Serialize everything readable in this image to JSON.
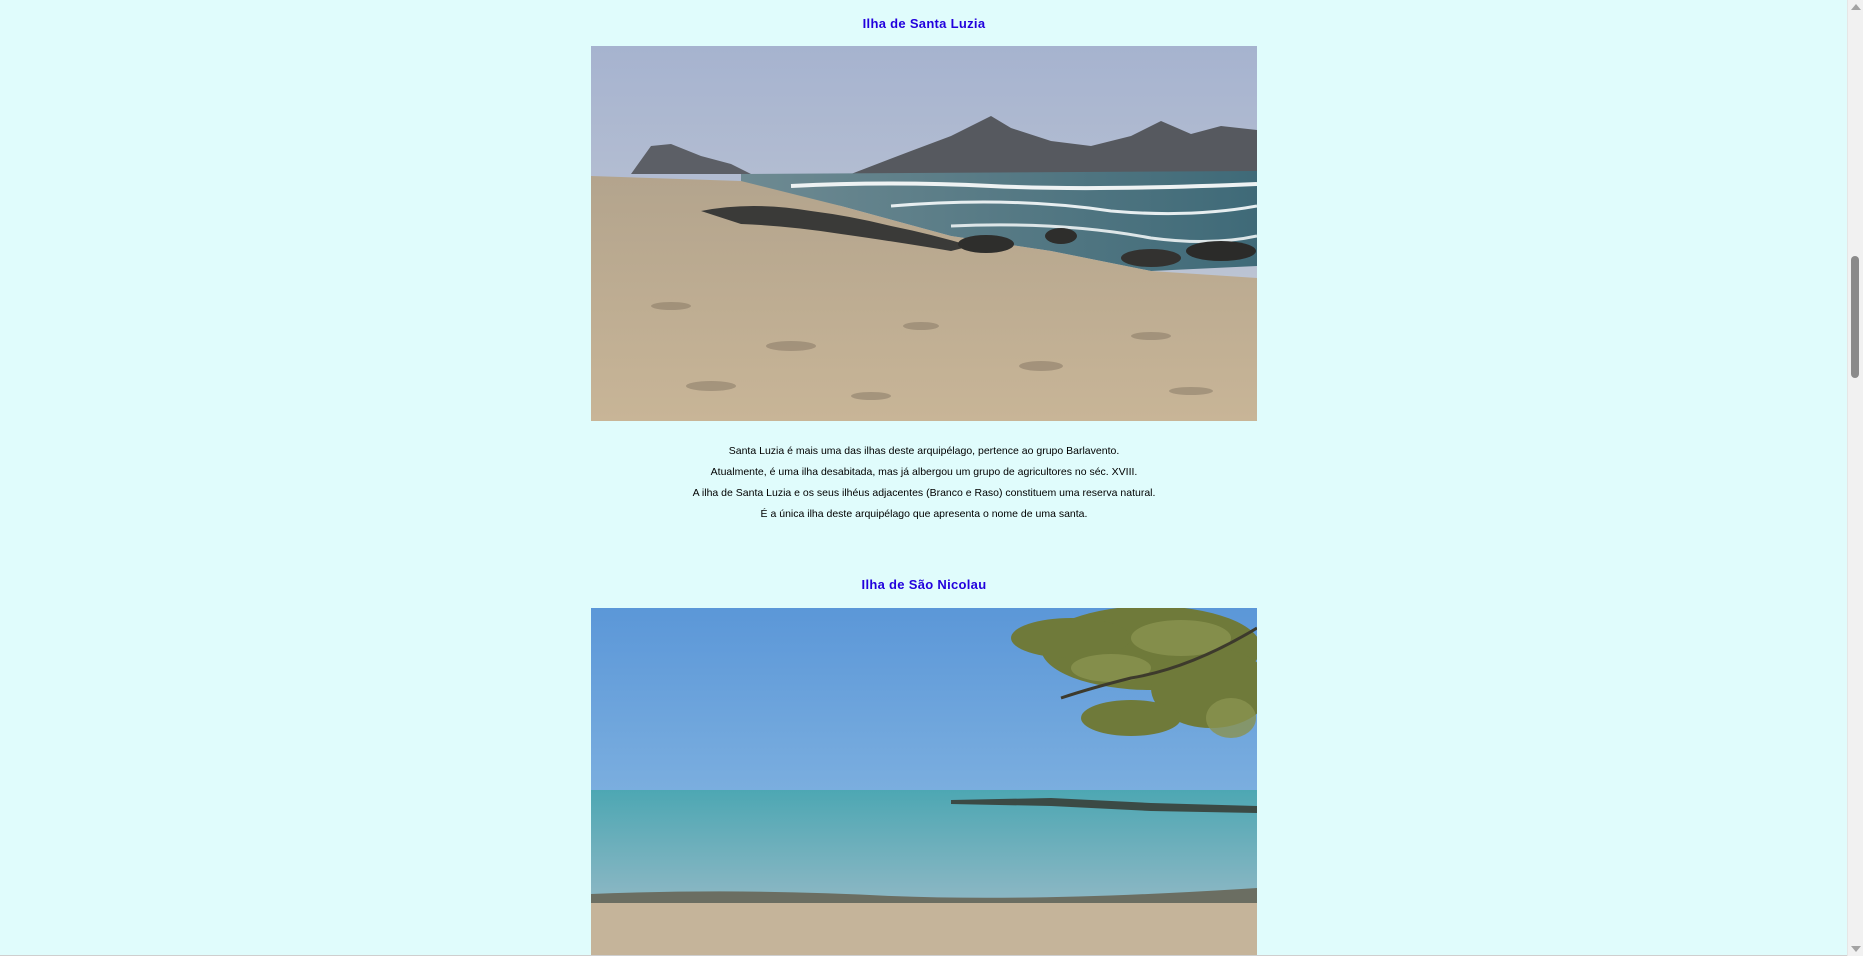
{
  "sections": [
    {
      "title": "Ilha de Santa Luzia",
      "image_icon": "beach-photo-santa-luzia",
      "paragraphs": [
        "Santa Luzia é mais uma das ilhas deste arquipélago, pertence ao grupo Barlavento.",
        "Atualmente, é uma ilha desabitada, mas já albergou um grupo de agricultores no séc. XVIII.",
        "A ilha de Santa Luzia e os seus ilhéus adjacentes (Branco e Raso) constituem uma reserva natural.",
        "É a única ilha deste arquipélago que apresenta o nome de uma santa."
      ]
    },
    {
      "title": "Ilha de São Nicolau",
      "image_icon": "beach-photo-sao-nicolau"
    }
  ],
  "colors": {
    "background": "#e0fcfc",
    "title": "#2200dd"
  }
}
